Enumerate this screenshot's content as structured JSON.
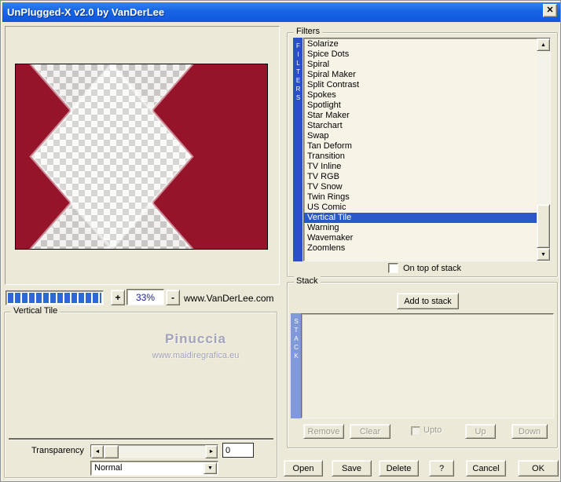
{
  "window": {
    "title": "UnPlugged-X v2.0 by VanDerLee",
    "close_icon": "✕"
  },
  "preview": {
    "zoom_in": "+",
    "zoom_out": "-",
    "zoom_level": "33%",
    "website": "www.VanDerLee.com"
  },
  "filters": {
    "group_label": "Filters",
    "sidebar_label": "FILTERS",
    "items": [
      "Solarize",
      "Spice Dots",
      "Spiral",
      "Spiral Maker",
      "Split Contrast",
      "Spokes",
      "Spotlight",
      "Star Maker",
      "Starchart",
      "Swap",
      "Tan Deform",
      "Transition",
      "TV Inline",
      "TV RGB",
      "TV Snow",
      "Twin Rings",
      "US Comic",
      "Vertical Tile",
      "Warning",
      "Wavemaker",
      "Zoomlens"
    ],
    "selected_item": "Vertical Tile",
    "on_top_label": "On top of stack",
    "scroll_up_icon": "▲",
    "scroll_down_icon": "▼"
  },
  "stack": {
    "group_label": "Stack",
    "sidebar_label": "STACK",
    "add_button": "Add to stack",
    "remove_button": "Remove",
    "clear_button": "Clear",
    "upto_label": "Upto",
    "up_button": "Up",
    "down_button": "Down",
    "items": []
  },
  "params": {
    "group_label": "Vertical Tile",
    "watermark_line1": "Pinuccia",
    "watermark_line2": "www.maidiregrafica.eu",
    "transparency_label": "Transparency",
    "transparency_value": "0",
    "blend_mode_value": "Normal",
    "slider_left_icon": "◄",
    "slider_right_icon": "►",
    "combo_arrow_icon": "▼"
  },
  "actions": {
    "open": "Open",
    "save": "Save",
    "delete": "Delete",
    "help": "?",
    "cancel": "Cancel",
    "ok": "OK"
  },
  "colors": {
    "dialog_beige": "#ECE9D8",
    "titlebar_blue": "#1765E4",
    "filters_bar_blue": "#2A4FC9",
    "stack_bar_blue": "#8098DC",
    "selection_blue": "#2A58C8",
    "progress_blue": "#2F66D8",
    "zoom_text_navy": "#161E8F",
    "preview_red": "#96142A",
    "watermark_gray": "#A2A3BC"
  }
}
